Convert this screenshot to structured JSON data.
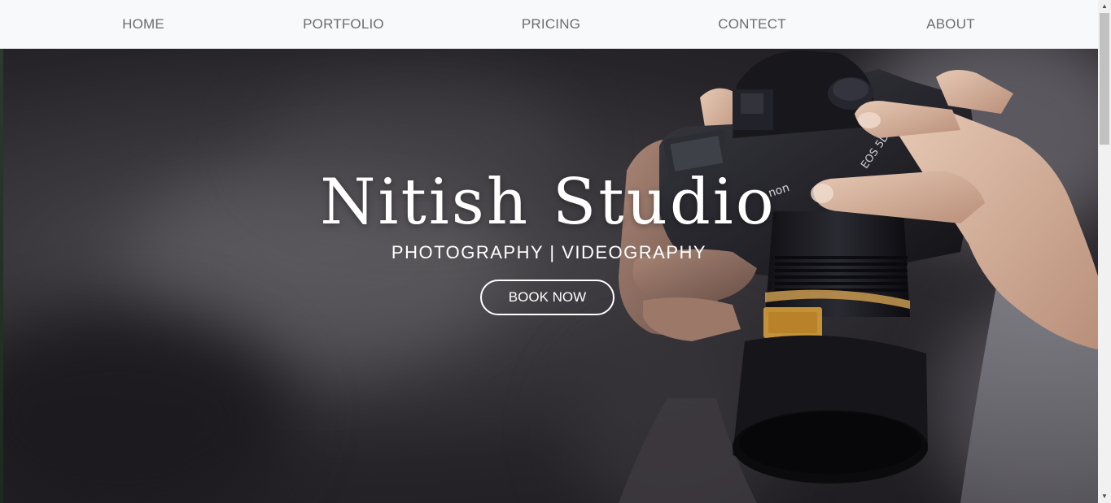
{
  "nav": {
    "items": [
      {
        "label": "HOME"
      },
      {
        "label": "PORTFOLIO"
      },
      {
        "label": "PRICING"
      },
      {
        "label": "CONTECT"
      },
      {
        "label": "ABOUT"
      }
    ]
  },
  "hero": {
    "title": "Nitish Studio",
    "subtitle": "PHOTOGRAPHY | VIDEOGRAPHY",
    "cta_label": "BOOK NOW",
    "camera_markings": {
      "brand_text": "non",
      "model_text": "EOS 5D"
    }
  },
  "colors": {
    "nav_background": "#f8f9fa",
    "nav_text": "#6c6c6c",
    "hero_text": "#ffffff"
  }
}
